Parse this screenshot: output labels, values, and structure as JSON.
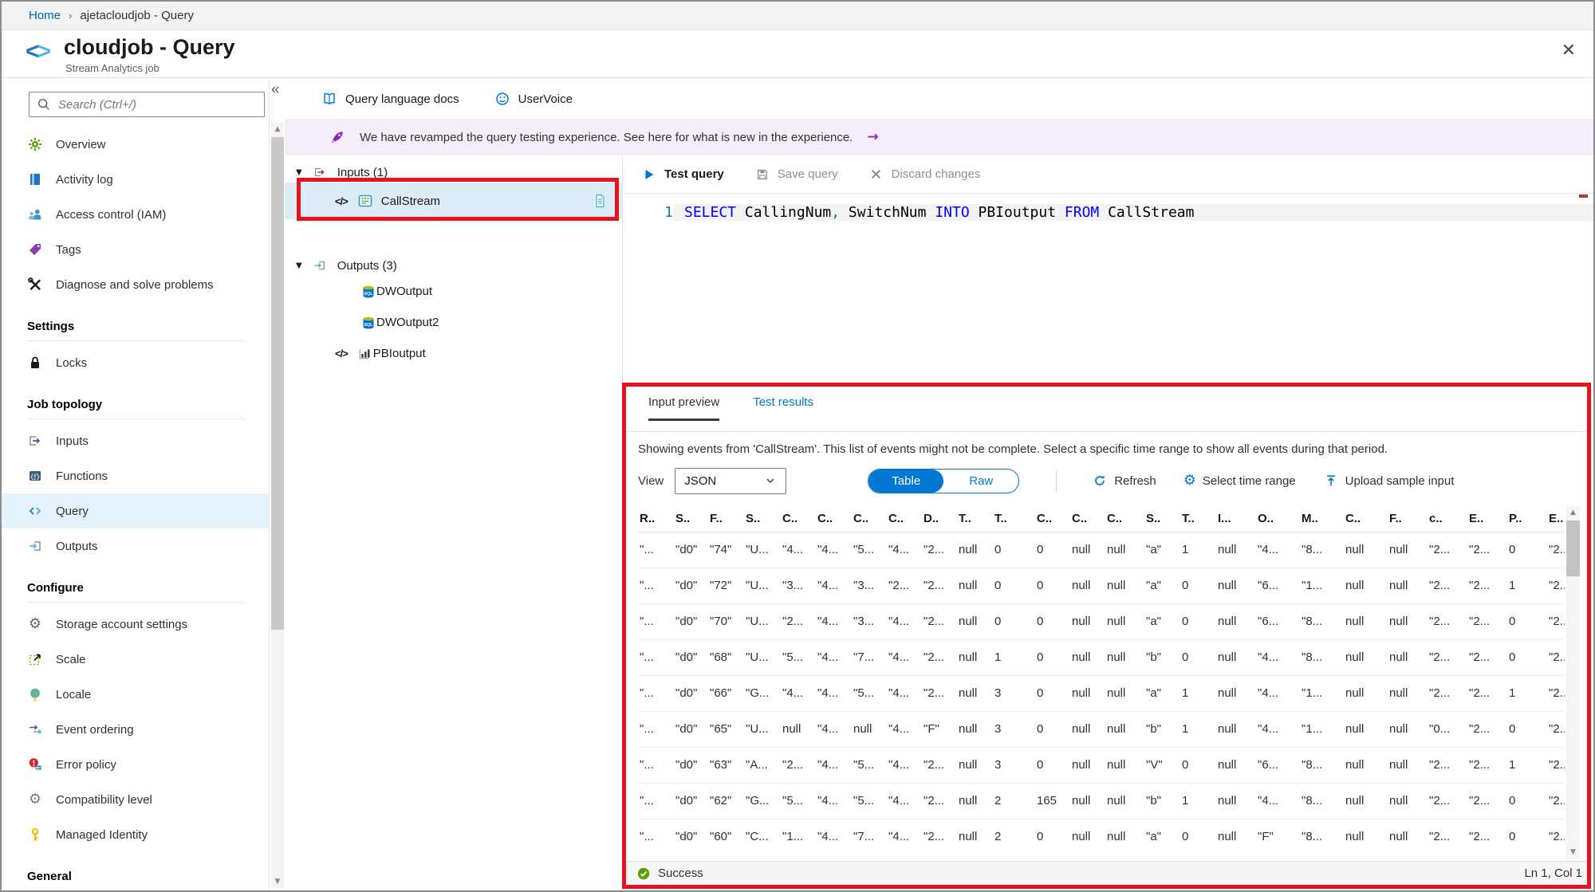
{
  "breadcrumb": {
    "home": "Home",
    "separator": "›",
    "current": "ajetacloudjob - Query"
  },
  "header": {
    "title": "cloudjob - Query",
    "subtitle": "Stream Analytics job",
    "close": "✕"
  },
  "sidebar": {
    "search_placeholder": "Search (Ctrl+/)",
    "collapse_glyph": "«",
    "sections": [
      {
        "header": "",
        "items": [
          {
            "label": "Overview",
            "icon": "overview-icon"
          },
          {
            "label": "Activity log",
            "icon": "activity-log-icon"
          },
          {
            "label": "Access control (IAM)",
            "icon": "access-control-icon"
          },
          {
            "label": "Tags",
            "icon": "tags-icon"
          },
          {
            "label": "Diagnose and solve problems",
            "icon": "diagnose-icon"
          }
        ]
      },
      {
        "header": "Settings",
        "items": [
          {
            "label": "Locks",
            "icon": "lock-icon"
          }
        ]
      },
      {
        "header": "Job topology",
        "items": [
          {
            "label": "Inputs",
            "icon": "inputs-icon"
          },
          {
            "label": "Functions",
            "icon": "functions-icon"
          },
          {
            "label": "Query",
            "icon": "query-icon",
            "selected": true
          },
          {
            "label": "Outputs",
            "icon": "outputs-icon"
          }
        ]
      },
      {
        "header": "Configure",
        "items": [
          {
            "label": "Storage account settings",
            "icon": "gear-icon"
          },
          {
            "label": "Scale",
            "icon": "scale-icon"
          },
          {
            "label": "Locale",
            "icon": "locale-icon"
          },
          {
            "label": "Event ordering",
            "icon": "event-ordering-icon"
          },
          {
            "label": "Error policy",
            "icon": "error-policy-icon"
          },
          {
            "label": "Compatibility level",
            "icon": "compatibility-icon"
          },
          {
            "label": "Managed Identity",
            "icon": "managed-identity-icon"
          }
        ]
      },
      {
        "header": "General",
        "items": []
      }
    ]
  },
  "toolbar": {
    "docs": "Query language docs",
    "uservoice": "UserVoice"
  },
  "banner": {
    "text": "We have revamped the query testing experience. See here for what is new in the experience.",
    "arrow": "→"
  },
  "tree": {
    "inputs_label": "Inputs (1)",
    "inputs": [
      {
        "name": "CallStream"
      }
    ],
    "outputs_label": "Outputs (3)",
    "outputs": [
      {
        "name": "DWOutput",
        "type": "sql"
      },
      {
        "name": "DWOutput2",
        "type": "sql"
      },
      {
        "name": "PBIoutput",
        "type": "powerbi"
      }
    ]
  },
  "editor": {
    "test_query": "Test query",
    "save_query": "Save query",
    "discard_changes": "Discard changes",
    "line_number": "1",
    "query_tokens": [
      {
        "t": "SELECT",
        "c": "kw"
      },
      {
        "t": " CallingNum",
        "c": "id"
      },
      {
        "t": ",",
        "c": "pu"
      },
      {
        "t": " SwitchNum ",
        "c": "id"
      },
      {
        "t": "INTO",
        "c": "kw"
      },
      {
        "t": " PBIoutput ",
        "c": "id"
      },
      {
        "t": "FROM",
        "c": "kw"
      },
      {
        "t": " CallStream",
        "c": "id"
      }
    ]
  },
  "results": {
    "tabs": [
      {
        "label": "Input preview",
        "active": true
      },
      {
        "label": "Test results",
        "active": false
      }
    ],
    "message": "Showing events from 'CallStream'. This list of events might not be complete. Select a specific time range to show all events during that period.",
    "view_label": "View",
    "view_value": "JSON",
    "toggle": {
      "left": "Table",
      "right": "Raw",
      "selected": "Table"
    },
    "actions": [
      {
        "label": "Refresh",
        "icon": "refresh-icon"
      },
      {
        "label": "Select time range",
        "icon": "time-gear-icon"
      },
      {
        "label": "Upload sample input",
        "icon": "upload-icon"
      }
    ],
    "table": {
      "headers": [
        "R..",
        "S..",
        "F..",
        "S..",
        "C..",
        "C..",
        "C..",
        "C..",
        "D..",
        "T..",
        "T..",
        "C..",
        "C..",
        "C..",
        "S..",
        "T..",
        "I...",
        "O..",
        "M..",
        "C..",
        "F..",
        "c..",
        "E..",
        "P..",
        "E.."
      ],
      "rows": [
        [
          "\"...",
          "\"d0\"",
          "\"74\"",
          "\"U...",
          "\"4...",
          "\"4...",
          "\"5...",
          "\"4...",
          "\"2...",
          "null",
          "0",
          "0",
          "null",
          "null",
          "\"a\"",
          "1",
          "null",
          "\"4...",
          "\"8...",
          "null",
          "null",
          "\"2...",
          "\"2...",
          "0",
          "\"2..."
        ],
        [
          "\"...",
          "\"d0\"",
          "\"72\"",
          "\"U...",
          "\"3...",
          "\"4...",
          "\"3...",
          "\"2...",
          "\"2...",
          "null",
          "0",
          "0",
          "null",
          "null",
          "\"a\"",
          "0",
          "null",
          "\"6...",
          "\"1...",
          "null",
          "null",
          "\"2...",
          "\"2...",
          "1",
          "\"2..."
        ],
        [
          "\"...",
          "\"d0\"",
          "\"70\"",
          "\"U...",
          "\"2...",
          "\"4...",
          "\"3...",
          "\"4...",
          "\"2...",
          "null",
          "0",
          "0",
          "null",
          "null",
          "\"a\"",
          "0",
          "null",
          "\"6...",
          "\"8...",
          "null",
          "null",
          "\"2...",
          "\"2...",
          "0",
          "\"2..."
        ],
        [
          "\"...",
          "\"d0\"",
          "\"68\"",
          "\"U...",
          "\"5...",
          "\"4...",
          "\"7...",
          "\"4...",
          "\"2...",
          "null",
          "1",
          "0",
          "null",
          "null",
          "\"b\"",
          "0",
          "null",
          "\"4...",
          "\"8...",
          "null",
          "null",
          "\"2...",
          "\"2...",
          "0",
          "\"2..."
        ],
        [
          "\"...",
          "\"d0\"",
          "\"66\"",
          "\"G...",
          "\"4...",
          "\"4...",
          "\"5...",
          "\"4...",
          "\"2...",
          "null",
          "3",
          "0",
          "null",
          "null",
          "\"a\"",
          "1",
          "null",
          "\"4...",
          "\"1...",
          "null",
          "null",
          "\"2...",
          "\"2...",
          "1",
          "\"2..."
        ],
        [
          "\"...",
          "\"d0\"",
          "\"65\"",
          "\"U...",
          "null",
          "\"4...",
          "null",
          "\"4...",
          "\"F\"",
          "null",
          "3",
          "0",
          "null",
          "null",
          "\"b\"",
          "1",
          "null",
          "\"4...",
          "\"1...",
          "null",
          "null",
          "\"0...",
          "\"2...",
          "0",
          "\"2..."
        ],
        [
          "\"...",
          "\"d0\"",
          "\"63\"",
          "\"A...",
          "\"2...",
          "\"4...",
          "\"5...",
          "\"4...",
          "\"2...",
          "null",
          "3",
          "0",
          "null",
          "null",
          "\"V\"",
          "0",
          "null",
          "\"6...",
          "\"8...",
          "null",
          "null",
          "\"2...",
          "\"2...",
          "1",
          "\"2..."
        ],
        [
          "\"...",
          "\"d0\"",
          "\"62\"",
          "\"G...",
          "\"5...",
          "\"4...",
          "\"5...",
          "\"4...",
          "\"2...",
          "null",
          "2",
          "165",
          "null",
          "null",
          "\"b\"",
          "1",
          "null",
          "\"4...",
          "\"8...",
          "null",
          "null",
          "\"2...",
          "\"2...",
          "0",
          "\"2..."
        ],
        [
          "\"...",
          "\"d0\"",
          "\"60\"",
          "\"C...",
          "\"1...",
          "\"4...",
          "\"7...",
          "\"4...",
          "\"2...",
          "null",
          "2",
          "0",
          "null",
          "null",
          "\"a\"",
          "0",
          "null",
          "\"F\"",
          "\"8...",
          "null",
          "null",
          "\"2...",
          "\"2...",
          "0",
          "\"2..."
        ]
      ]
    },
    "status": {
      "text": "Success"
    },
    "position": "Ln 1, Col 1"
  },
  "colors": {
    "accent": "#0078d4",
    "highlight_red": "#e8111d",
    "success_green": "#57a300",
    "banner_purple": "#f5eef8",
    "selected_blue": "#e3f2fb"
  }
}
